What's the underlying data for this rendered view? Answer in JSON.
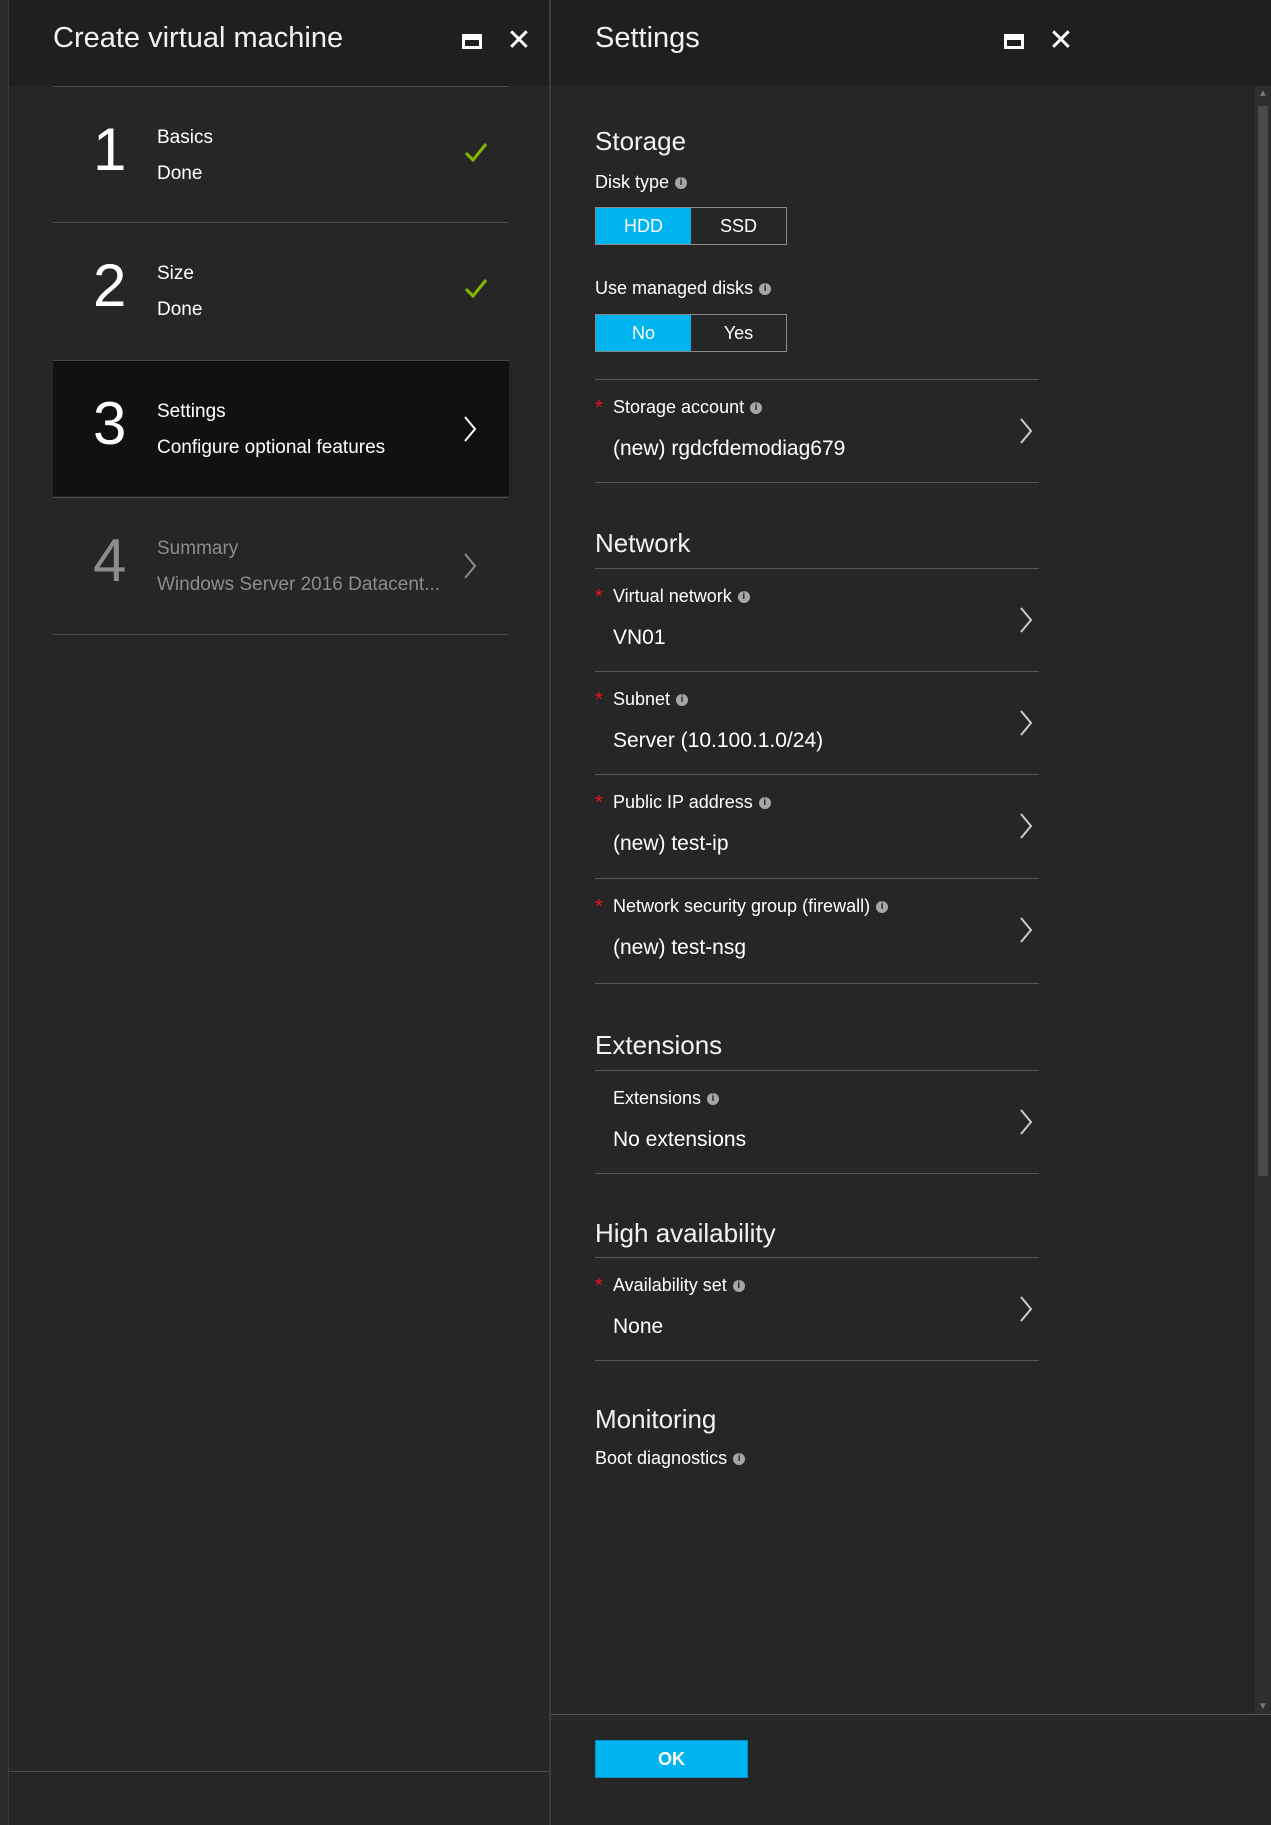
{
  "left_blade": {
    "title": "Create virtual machine",
    "steps": [
      {
        "number": "1",
        "title": "Basics",
        "subtitle": "Done",
        "state": "done"
      },
      {
        "number": "2",
        "title": "Size",
        "subtitle": "Done",
        "state": "done"
      },
      {
        "number": "3",
        "title": "Settings",
        "subtitle": "Configure optional features",
        "state": "active"
      },
      {
        "number": "4",
        "title": "Summary",
        "subtitle": "Windows Server 2016 Datacent...",
        "state": "disabled"
      }
    ]
  },
  "right_blade": {
    "title": "Settings",
    "storage": {
      "heading": "Storage",
      "disk_type_label": "Disk type",
      "disk_type_options": [
        "HDD",
        "SSD"
      ],
      "disk_type_selected": "HDD",
      "managed_disks_label": "Use managed disks",
      "managed_disks_options": [
        "No",
        "Yes"
      ],
      "managed_disks_selected": "No",
      "storage_account_label": "Storage account",
      "storage_account_value": "(new) rgdcfdemodiag679"
    },
    "network": {
      "heading": "Network",
      "vnet_label": "Virtual network",
      "vnet_value": "VN01",
      "subnet_label": "Subnet",
      "subnet_value": "Server (10.100.1.0/24)",
      "pip_label": "Public IP address",
      "pip_value": "(new) test-ip",
      "nsg_label": "Network security group (firewall)",
      "nsg_value": "(new) test-nsg"
    },
    "extensions": {
      "heading": "Extensions",
      "label": "Extensions",
      "value": "No extensions"
    },
    "high_availability": {
      "heading": "High availability",
      "label": "Availability set",
      "value": "None"
    },
    "monitoring": {
      "heading": "Monitoring",
      "boot_diag_label": "Boot diagnostics"
    },
    "ok_label": "OK"
  },
  "icons": {
    "info": "i",
    "check_color": "#7fba00",
    "accent": "#00b4f0",
    "required_color": "#e81123"
  }
}
